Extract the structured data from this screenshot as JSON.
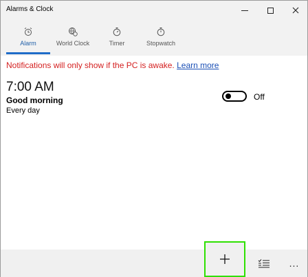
{
  "window": {
    "title": "Alarms & Clock"
  },
  "tabs": [
    {
      "label": "Alarm",
      "icon": "alarm-clock-icon",
      "active": true
    },
    {
      "label": "World Clock",
      "icon": "world-clock-icon",
      "active": false
    },
    {
      "label": "Timer",
      "icon": "timer-icon",
      "active": false
    },
    {
      "label": "Stopwatch",
      "icon": "stopwatch-icon",
      "active": false
    }
  ],
  "notice": {
    "text": "Notifications will only show if the PC is awake.",
    "link": "Learn more",
    "color": "#d42020",
    "link_color": "#1a4fb5"
  },
  "alarm": {
    "time": "7:00 AM",
    "name": "Good morning",
    "repeat": "Every day",
    "toggle_state": "Off"
  },
  "commands": {
    "add": "add-icon",
    "select": "select-icon",
    "more": "..."
  },
  "colors": {
    "accent": "#1f6cc8",
    "highlight": "#2ee000"
  }
}
